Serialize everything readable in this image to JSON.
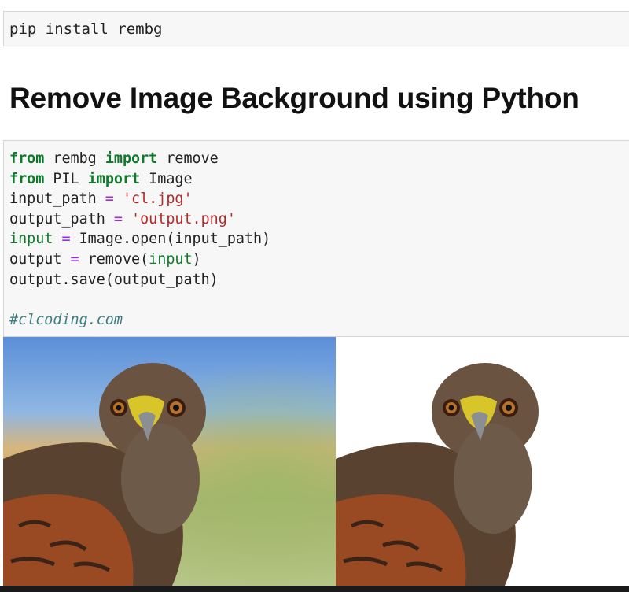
{
  "install_cell": {
    "command": "pip install rembg"
  },
  "heading": "Remove Image Background using Python",
  "code": {
    "l1": {
      "kw1": "from",
      "mod": " rembg ",
      "kw2": "import",
      "name": " remove"
    },
    "l2": {
      "kw1": "from",
      "mod": " PIL ",
      "kw2": "import",
      "name": " Image"
    },
    "l3": {
      "var": "input_path ",
      "op": "=",
      "sp": " ",
      "str": "'cl.jpg'"
    },
    "l4": {
      "var": "output_path ",
      "op": "=",
      "sp": " ",
      "str": "'output.png'"
    },
    "l5": {
      "var": "input",
      "sp1": " ",
      "op": "=",
      "rest": " Image.open(input_path)"
    },
    "l6": {
      "var": "output ",
      "op": "=",
      "mid": " remove(",
      "arg": "input",
      "end": ")"
    },
    "l7": {
      "text": "output.save(output_path)"
    },
    "comment": "#clcoding.com"
  },
  "colors": {
    "keyword": "#0f7a2a",
    "operator": "#9a2be2",
    "string": "#b42a2a",
    "comment": "#3d7d80"
  },
  "images": {
    "left": "hawk photo with blurred blue/green background",
    "right": "hawk photo with background removed"
  }
}
